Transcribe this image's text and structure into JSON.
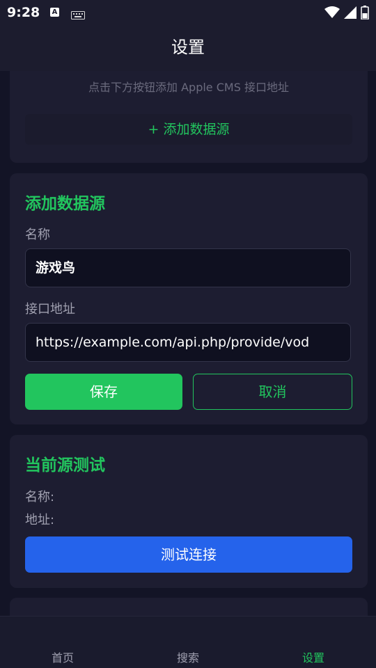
{
  "status_bar": {
    "time": "9:28",
    "a_icon_letter": "A",
    "icons": [
      "a-badge-icon",
      "keyboard-icon",
      "wifi-icon",
      "signal-icon",
      "battery-icon"
    ]
  },
  "header": {
    "title": "设置"
  },
  "source_card": {
    "hint": "点击下方按钮添加 Apple CMS 接口地址",
    "add_button": "+ 添加数据源"
  },
  "add_form": {
    "title": "添加数据源",
    "name_label": "名称",
    "name_value": "游戏鸟",
    "url_label": "接口地址",
    "url_value": "https://example.com/api.php/provide/vod",
    "save": "保存",
    "cancel": "取消"
  },
  "test_card": {
    "title": "当前源测试",
    "name_line": "名称:",
    "url_line": "地址:",
    "test_button": "测试连接"
  },
  "tabs": [
    {
      "label": "首页",
      "active": false
    },
    {
      "label": "搜索",
      "active": false
    },
    {
      "label": "设置",
      "active": true
    }
  ],
  "colors": {
    "accent": "#22c55e",
    "primary_button": "#2563eb",
    "background": "#131426",
    "card": "#1d1d31"
  }
}
